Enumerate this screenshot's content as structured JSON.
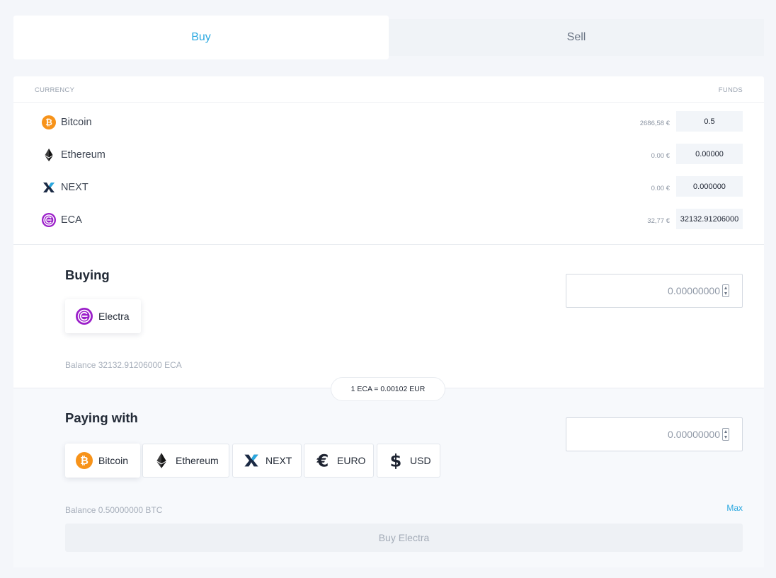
{
  "tabs": {
    "buy": "Buy",
    "sell": "Sell"
  },
  "funds": {
    "currency_header": "CURRENCY",
    "funds_header": "FUNDS",
    "rows": [
      {
        "name": "Bitcoin",
        "eur": "2686,58 €",
        "amount": "0.5",
        "icon": "bitcoin-icon"
      },
      {
        "name": "Ethereum",
        "eur": "0.00 €",
        "amount": "0.00000",
        "icon": "ethereum-icon"
      },
      {
        "name": "NEXT",
        "eur": "0.00 €",
        "amount": "0.000000",
        "icon": "next-icon"
      },
      {
        "name": "ECA",
        "eur": "32,77 €",
        "amount": "32132.91206000",
        "icon": "electra-icon"
      }
    ]
  },
  "buying": {
    "title": "Buying",
    "selected_currency": "Electra",
    "amount": "0.00000000",
    "balance": "Balance 32132.91206000 ECA"
  },
  "rate": "1 ECA = 0.00102 EUR",
  "paying": {
    "title": "Paying with",
    "amount": "0.00000000",
    "options": [
      {
        "label": "Bitcoin",
        "icon": "bitcoin-icon",
        "selected": true
      },
      {
        "label": "Ethereum",
        "icon": "ethereum-icon",
        "selected": false
      },
      {
        "label": "NEXT",
        "icon": "next-icon",
        "selected": false
      },
      {
        "label": "EURO",
        "icon": "euro-icon",
        "selected": false
      },
      {
        "label": "USD",
        "icon": "dollar-icon",
        "selected": false
      }
    ],
    "balance": "Balance 0.50000000 BTC",
    "max": "Max"
  },
  "action": {
    "buy_button": "Buy Electra"
  },
  "colors": {
    "accent": "#2aa8e0",
    "bitcoin": "#f7931a",
    "electra": "#9b1fc9",
    "next": "#1b2a44"
  }
}
